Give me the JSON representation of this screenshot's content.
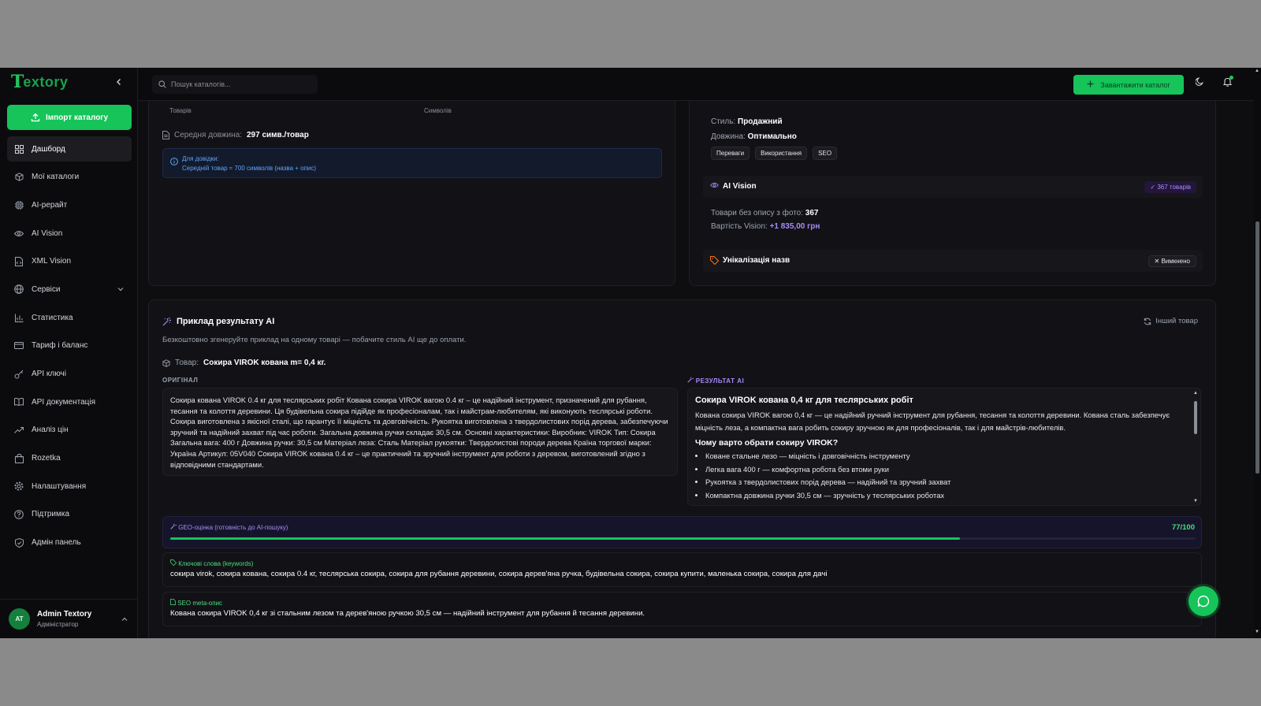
{
  "brand": {
    "mark": "T",
    "word": "extory"
  },
  "sidebar": {
    "import_label": "Імпорт каталогу",
    "items": [
      {
        "label": "Дашборд",
        "icon": "dashboard-icon"
      },
      {
        "label": "Мої каталоги",
        "icon": "box-icon"
      },
      {
        "label": "AI-рерайт",
        "icon": "cpu-icon"
      },
      {
        "label": "AI Vision",
        "icon": "eye-icon"
      },
      {
        "label": "XML Vision",
        "icon": "file-code-icon"
      },
      {
        "label": "Сервіси",
        "icon": "globe-icon"
      },
      {
        "label": "Статистика",
        "icon": "bar-chart-icon"
      },
      {
        "label": "Тариф і баланс",
        "icon": "credit-card-icon"
      },
      {
        "label": "API ключі",
        "icon": "key-icon"
      },
      {
        "label": "API документація",
        "icon": "book-icon"
      },
      {
        "label": "Аналіз цін",
        "icon": "trending-up-icon"
      },
      {
        "label": "Rozetka",
        "icon": "shopping-bag-icon"
      },
      {
        "label": "Налаштування",
        "icon": "gear-icon"
      },
      {
        "label": "Підтримка",
        "icon": "help-circle-icon"
      },
      {
        "label": "Адмін панель",
        "icon": "shield-icon"
      }
    ]
  },
  "user": {
    "initials": "AT",
    "name": "Admin Textory",
    "role": "Адміністратор"
  },
  "topbar": {
    "search_placeholder": "Пошук каталогів...",
    "upload_label": "Завантажити каталог"
  },
  "stats": {
    "products_label": "Товарів",
    "symbols_label": "Символів",
    "avg_length_label": "Середня довжина:",
    "avg_length_value": "297 симв./товар",
    "info_title": "Для довідки:",
    "info_text": "Середній товар ≈ 700 символів (назва + опис)"
  },
  "settings": {
    "style_label": "Стиль:",
    "style_value": "Продажний",
    "length_label": "Довжина:",
    "length_value": "Оптимально",
    "tags": [
      "Переваги",
      "Використання",
      "SEO"
    ],
    "ai_vision_title": "AI Vision",
    "ai_vision_badge": "367 товарів",
    "no_desc_label": "Товари без опису з фото:",
    "no_desc_value": "367",
    "vision_cost_label": "Вартість Vision:",
    "vision_cost_value": "+1 835,00 грн",
    "unique_title": "Унікалізація назв",
    "unique_badge": "Вимкнено"
  },
  "example": {
    "title": "Приклад результату AI",
    "subtitle": "Безкоштовно згенеруйте приклад на одному товарі — побачите стиль AI ще до оплати.",
    "other_label": "Інший товар",
    "product_label": "Товар:",
    "product_name": "Сокира VIROK кована m= 0,4 кг.",
    "original_label": "ОРИГІНАЛ",
    "original_text": "Сокира кована VIROK 0.4 кг для теслярських робіт Кована сокира VIROK вагою 0.4 кг – це надійний інструмент, призначений для рубання, тесання та колоття деревини. Ця будівельна сокира підійде як професіоналам, так і майстрам-любителям, які виконують теслярські роботи. Сокира виготовлена з якісної сталі, що гарантує її міцність та довговічність. Рукоятка виготовлена з твердолистових порід дерева, забезпечуючи зручний та надійний захват під час роботи. Загальна довжина ручки складає 30,5 см. Основні характеристики: Виробник: VIROK Тип: Сокира Загальна вага: 400 г Довжина ручки: 30,5 см Матеріал леза: Сталь Матеріал рукоятки: Твердолистові породи дерева Країна торгової марки: Україна Артикул: 05V040 Сокира VIROK кована 0.4 кг – це практичний та зручний інструмент для роботи з деревом, виготовлений згідно з відповідними стандартами.",
    "result_label": "РЕЗУЛЬТАТ AI",
    "result_title": "Сокира VIROK кована 0,4 кг для теслярських робіт",
    "result_text": "Кована сокира VIROK вагою 0,4 кг — це надійний ручний інструмент для рубання, тесання та колоття деревини. Кована сталь забезпечує міцність леза, а компактна вага робить сокиру зручною як для професіоналів, так і для майстрів-любителів.",
    "result_subtitle": "Чому варто обрати сокиру VIROK?",
    "result_bullets": [
      "Коване стальне лезо — міцність і довговічність інструменту",
      "Легка вага 400 г — комфортна робота без втоми руки",
      "Рукоятка з твердолистових порід дерева — надійний та зручний захват",
      "Компактна довжина ручки 30,5 см — зручність у теслярських роботах"
    ],
    "geo_label": "GEO-оцінка (готовність до AI-пошуку)",
    "geo_score": "77/100",
    "geo_value": 77,
    "geo_max": 100,
    "keywords_label": "Ключові слова (keywords)",
    "keywords_text": "сокира virok, сокира кована, сокира 0.4 кг, теслярська сокира, сокира для рубання деревини, сокира дерев'яна ручка, будівельна сокира, сокира купити, маленька сокира, сокира для дачі",
    "meta_label": "SEO meta-опис",
    "meta_text": "Кована сокира VIROK 0,4 кг зі стальним лезом та дерев'яною ручкою 30,5 см — надійний інструмент для рубання й тесання деревини."
  },
  "colors": {
    "accent": "#16c45a",
    "purple": "#a78bfa",
    "info": "#60a5fa"
  }
}
